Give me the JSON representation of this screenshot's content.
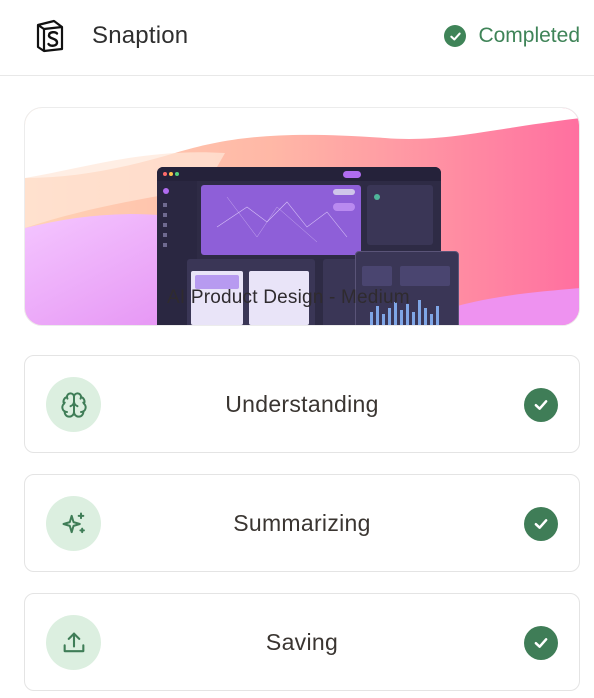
{
  "header": {
    "app_name": "Snaption",
    "status": {
      "text": "Completed",
      "icon": "check-circle-icon",
      "color": "#3f8458"
    }
  },
  "hero": {
    "title": "AI Product Design - Medium"
  },
  "steps": [
    {
      "label": "Understanding",
      "icon": "brain-icon",
      "status_icon": "check-circle-icon"
    },
    {
      "label": "Summarizing",
      "icon": "sparkles-icon",
      "status_icon": "check-circle-icon"
    },
    {
      "label": "Saving",
      "icon": "upload-icon",
      "status_icon": "check-circle-icon"
    }
  ],
  "colors": {
    "accent_green": "#3f7d57",
    "icon_bg": "#dcefe0"
  }
}
